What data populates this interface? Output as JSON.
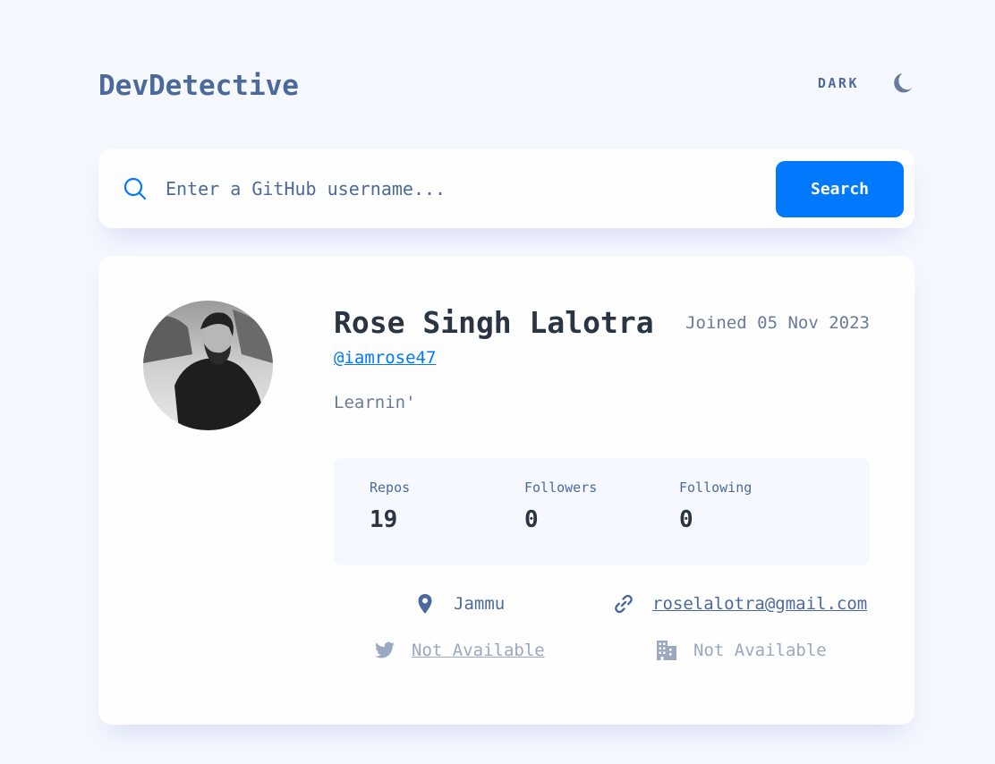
{
  "header": {
    "logo": "DevDetective",
    "mode_label": "DARK",
    "mode_icon": "moon-icon"
  },
  "search": {
    "placeholder": "Enter a GitHub username...",
    "value": "",
    "button_label": "Search",
    "icon": "search-icon"
  },
  "profile": {
    "name": "Rose Singh Lalotra",
    "joined": "Joined 05 Nov 2023",
    "login": "@iamrose47",
    "bio": "Learnin'",
    "avatar_icon": "avatar"
  },
  "stats": [
    {
      "label": "Repos",
      "value": "19"
    },
    {
      "label": "Followers",
      "value": "0"
    },
    {
      "label": "Following",
      "value": "0"
    }
  ],
  "links": {
    "location": {
      "icon": "location-pin-icon",
      "text": "Jammu"
    },
    "website": {
      "icon": "link-icon",
      "text": "roselalotra@gmail.com"
    },
    "twitter": {
      "icon": "twitter-icon",
      "text": "Not Available"
    },
    "company": {
      "icon": "building-icon",
      "text": "Not Available"
    }
  },
  "colors": {
    "background": "#f6f8ff",
    "card": "#fefefe",
    "accent": "#0079ff",
    "title": "#2b3442",
    "text": "#4b6a9b",
    "muted": "#697c9a",
    "unavailable": "#9aa8c1"
  }
}
